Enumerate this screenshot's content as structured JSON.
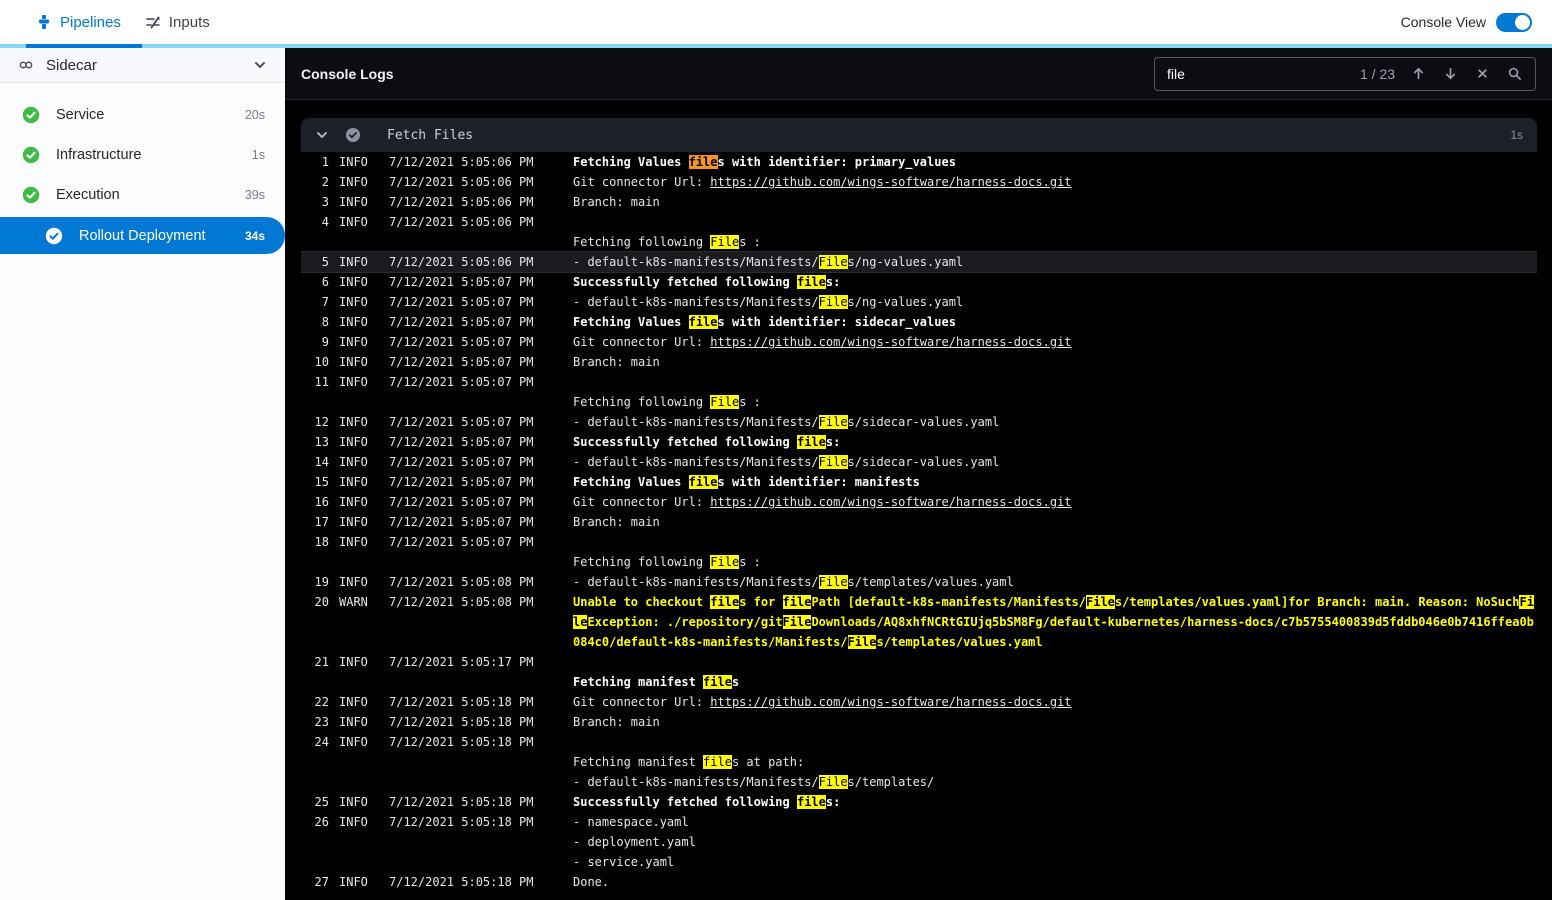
{
  "topnav": {
    "tabs": [
      {
        "label": "Pipelines"
      },
      {
        "label": "Inputs"
      }
    ],
    "console_view_label": "Console View",
    "toggle_on": true
  },
  "sidebar": {
    "title": "Sidecar",
    "steps": [
      {
        "label": "Service",
        "duration": "20s",
        "status": "success",
        "selected": false
      },
      {
        "label": "Infrastructure",
        "duration": "1s",
        "status": "success",
        "selected": false
      },
      {
        "label": "Execution",
        "duration": "39s",
        "status": "success",
        "selected": false
      },
      {
        "label": "Rollout Deployment",
        "duration": "34s",
        "status": "success",
        "selected": true
      }
    ]
  },
  "console": {
    "title": "Console Logs",
    "search": {
      "value": "file",
      "counter": "1 / 23"
    },
    "section": {
      "title": "Fetch Files",
      "duration": "1s"
    }
  },
  "colors": {
    "accent_blue": "#0278d5",
    "light_blue_bar": "#8bd6f2",
    "success_green": "#42ba47",
    "match_highlight": "#ffff00",
    "current_match_highlight": "#f7941e",
    "warn_text": "#ffff00"
  },
  "log": {
    "rows": [
      {
        "n": "1",
        "lv": "INFO",
        "ts": "7/12/2021 5:05:06 PM",
        "b": 1,
        "seg": [
          [
            "Fetching Values ",
            ""
          ],
          [
            "file",
            "c"
          ],
          [
            "s with identifier: primary_values",
            ""
          ]
        ]
      },
      {
        "n": "2",
        "lv": "INFO",
        "ts": "7/12/2021 5:05:06 PM",
        "seg": [
          [
            "Git connector Url: ",
            ""
          ],
          [
            "https://github.com/wings-software/harness-docs.git",
            "l"
          ]
        ]
      },
      {
        "n": "3",
        "lv": "INFO",
        "ts": "7/12/2021 5:05:06 PM",
        "seg": [
          [
            "Branch: main",
            ""
          ]
        ]
      },
      {
        "n": "4",
        "lv": "INFO",
        "ts": "7/12/2021 5:05:06 PM",
        "seg": []
      },
      {
        "seg": [
          [
            "Fetching following ",
            ""
          ],
          [
            "File",
            "m"
          ],
          [
            "s :",
            ""
          ]
        ]
      },
      {
        "n": "5",
        "lv": "INFO",
        "ts": "7/12/2021 5:05:06 PM",
        "hl": 1,
        "seg": [
          [
            "- default-k8s-manifests/Manifests/",
            ""
          ],
          [
            "File",
            "m"
          ],
          [
            "s/ng-values.yaml",
            ""
          ]
        ]
      },
      {
        "n": "6",
        "lv": "INFO",
        "ts": "7/12/2021 5:05:07 PM",
        "b": 1,
        "seg": [
          [
            "Successfully fetched following ",
            ""
          ],
          [
            "file",
            "m"
          ],
          [
            "s:",
            ""
          ]
        ]
      },
      {
        "n": "7",
        "lv": "INFO",
        "ts": "7/12/2021 5:05:07 PM",
        "seg": [
          [
            "- default-k8s-manifests/Manifests/",
            ""
          ],
          [
            "File",
            "m"
          ],
          [
            "s/ng-values.yaml",
            ""
          ]
        ]
      },
      {
        "n": "8",
        "lv": "INFO",
        "ts": "7/12/2021 5:05:07 PM",
        "b": 1,
        "seg": [
          [
            "Fetching Values ",
            ""
          ],
          [
            "file",
            "m"
          ],
          [
            "s with identifier: sidecar_values",
            ""
          ]
        ]
      },
      {
        "n": "9",
        "lv": "INFO",
        "ts": "7/12/2021 5:05:07 PM",
        "seg": [
          [
            "Git connector Url: ",
            ""
          ],
          [
            "https://github.com/wings-software/harness-docs.git",
            "l"
          ]
        ]
      },
      {
        "n": "10",
        "lv": "INFO",
        "ts": "7/12/2021 5:05:07 PM",
        "seg": [
          [
            "Branch: main",
            ""
          ]
        ]
      },
      {
        "n": "11",
        "lv": "INFO",
        "ts": "7/12/2021 5:05:07 PM",
        "seg": []
      },
      {
        "seg": [
          [
            "Fetching following ",
            ""
          ],
          [
            "File",
            "m"
          ],
          [
            "s :",
            ""
          ]
        ]
      },
      {
        "n": "12",
        "lv": "INFO",
        "ts": "7/12/2021 5:05:07 PM",
        "seg": [
          [
            "- default-k8s-manifests/Manifests/",
            ""
          ],
          [
            "File",
            "m"
          ],
          [
            "s/sidecar-values.yaml",
            ""
          ]
        ]
      },
      {
        "n": "13",
        "lv": "INFO",
        "ts": "7/12/2021 5:05:07 PM",
        "b": 1,
        "seg": [
          [
            "Successfully fetched following ",
            ""
          ],
          [
            "file",
            "m"
          ],
          [
            "s:",
            ""
          ]
        ]
      },
      {
        "n": "14",
        "lv": "INFO",
        "ts": "7/12/2021 5:05:07 PM",
        "seg": [
          [
            "- default-k8s-manifests/Manifests/",
            ""
          ],
          [
            "File",
            "m"
          ],
          [
            "s/sidecar-values.yaml",
            ""
          ]
        ]
      },
      {
        "n": "15",
        "lv": "INFO",
        "ts": "7/12/2021 5:05:07 PM",
        "b": 1,
        "seg": [
          [
            "Fetching Values ",
            ""
          ],
          [
            "file",
            "m"
          ],
          [
            "s with identifier: manifests",
            ""
          ]
        ]
      },
      {
        "n": "16",
        "lv": "INFO",
        "ts": "7/12/2021 5:05:07 PM",
        "seg": [
          [
            "Git connector Url: ",
            ""
          ],
          [
            "https://github.com/wings-software/harness-docs.git",
            "l"
          ]
        ]
      },
      {
        "n": "17",
        "lv": "INFO",
        "ts": "7/12/2021 5:05:07 PM",
        "seg": [
          [
            "Branch: main",
            ""
          ]
        ]
      },
      {
        "n": "18",
        "lv": "INFO",
        "ts": "7/12/2021 5:05:07 PM",
        "seg": []
      },
      {
        "seg": [
          [
            "Fetching following ",
            ""
          ],
          [
            "File",
            "m"
          ],
          [
            "s :",
            ""
          ]
        ]
      },
      {
        "n": "19",
        "lv": "INFO",
        "ts": "7/12/2021 5:05:08 PM",
        "seg": [
          [
            "- default-k8s-manifests/Manifests/",
            ""
          ],
          [
            "File",
            "m"
          ],
          [
            "s/templates/values.yaml",
            ""
          ]
        ]
      },
      {
        "n": "20",
        "lv": "WARN",
        "ts": "7/12/2021 5:05:08 PM",
        "warn": 1,
        "seg": [
          [
            "Unable to checkout ",
            ""
          ],
          [
            "file",
            "m"
          ],
          [
            "s for ",
            ""
          ],
          [
            "file",
            "m"
          ],
          [
            "Path [default-k8s-manifests/Manifests/",
            ""
          ],
          [
            "File",
            "m"
          ],
          [
            "s/templates/values.yaml]for Branch: main. Reason: NoSuch",
            ""
          ],
          [
            "File",
            "m"
          ],
          [
            "Exception: ./repository/git",
            ""
          ],
          [
            "File",
            "m"
          ],
          [
            "Downloads/AQ8xhfNCRtGIUjq5bSM8Fg/default-kubernetes/harness-docs/c7b5755400839d5fddb046e0b7416ffea0b084c0/default-k8s-manifests/Manifests/",
            ""
          ],
          [
            "File",
            "m"
          ],
          [
            "s/templates/values.yaml",
            ""
          ]
        ]
      },
      {
        "n": "21",
        "lv": "INFO",
        "ts": "7/12/2021 5:05:17 PM",
        "seg": []
      },
      {
        "b": 1,
        "seg": [
          [
            "Fetching manifest ",
            ""
          ],
          [
            "file",
            "m"
          ],
          [
            "s",
            ""
          ]
        ]
      },
      {
        "n": "22",
        "lv": "INFO",
        "ts": "7/12/2021 5:05:18 PM",
        "seg": [
          [
            "Git connector Url: ",
            ""
          ],
          [
            "https://github.com/wings-software/harness-docs.git",
            "l"
          ]
        ]
      },
      {
        "n": "23",
        "lv": "INFO",
        "ts": "7/12/2021 5:05:18 PM",
        "seg": [
          [
            "Branch: main",
            ""
          ]
        ]
      },
      {
        "n": "24",
        "lv": "INFO",
        "ts": "7/12/2021 5:05:18 PM",
        "seg": []
      },
      {
        "seg": [
          [
            "Fetching manifest ",
            ""
          ],
          [
            "file",
            "m"
          ],
          [
            "s at path:",
            ""
          ]
        ]
      },
      {
        "seg": [
          [
            "- default-k8s-manifests/Manifests/",
            ""
          ],
          [
            "File",
            "m"
          ],
          [
            "s/templates/",
            ""
          ]
        ]
      },
      {
        "n": "25",
        "lv": "INFO",
        "ts": "7/12/2021 5:05:18 PM",
        "b": 1,
        "seg": [
          [
            "Successfully fetched following ",
            ""
          ],
          [
            "file",
            "m"
          ],
          [
            "s:",
            ""
          ]
        ]
      },
      {
        "n": "26",
        "lv": "INFO",
        "ts": "7/12/2021 5:05:18 PM",
        "seg": [
          [
            "- namespace.yaml",
            ""
          ]
        ]
      },
      {
        "seg": [
          [
            "- deployment.yaml",
            ""
          ]
        ]
      },
      {
        "seg": [
          [
            "- service.yaml",
            ""
          ]
        ]
      },
      {
        "n": "27",
        "lv": "INFO",
        "ts": "7/12/2021 5:05:18 PM",
        "seg": [
          [
            "Done.",
            ""
          ]
        ]
      }
    ]
  }
}
